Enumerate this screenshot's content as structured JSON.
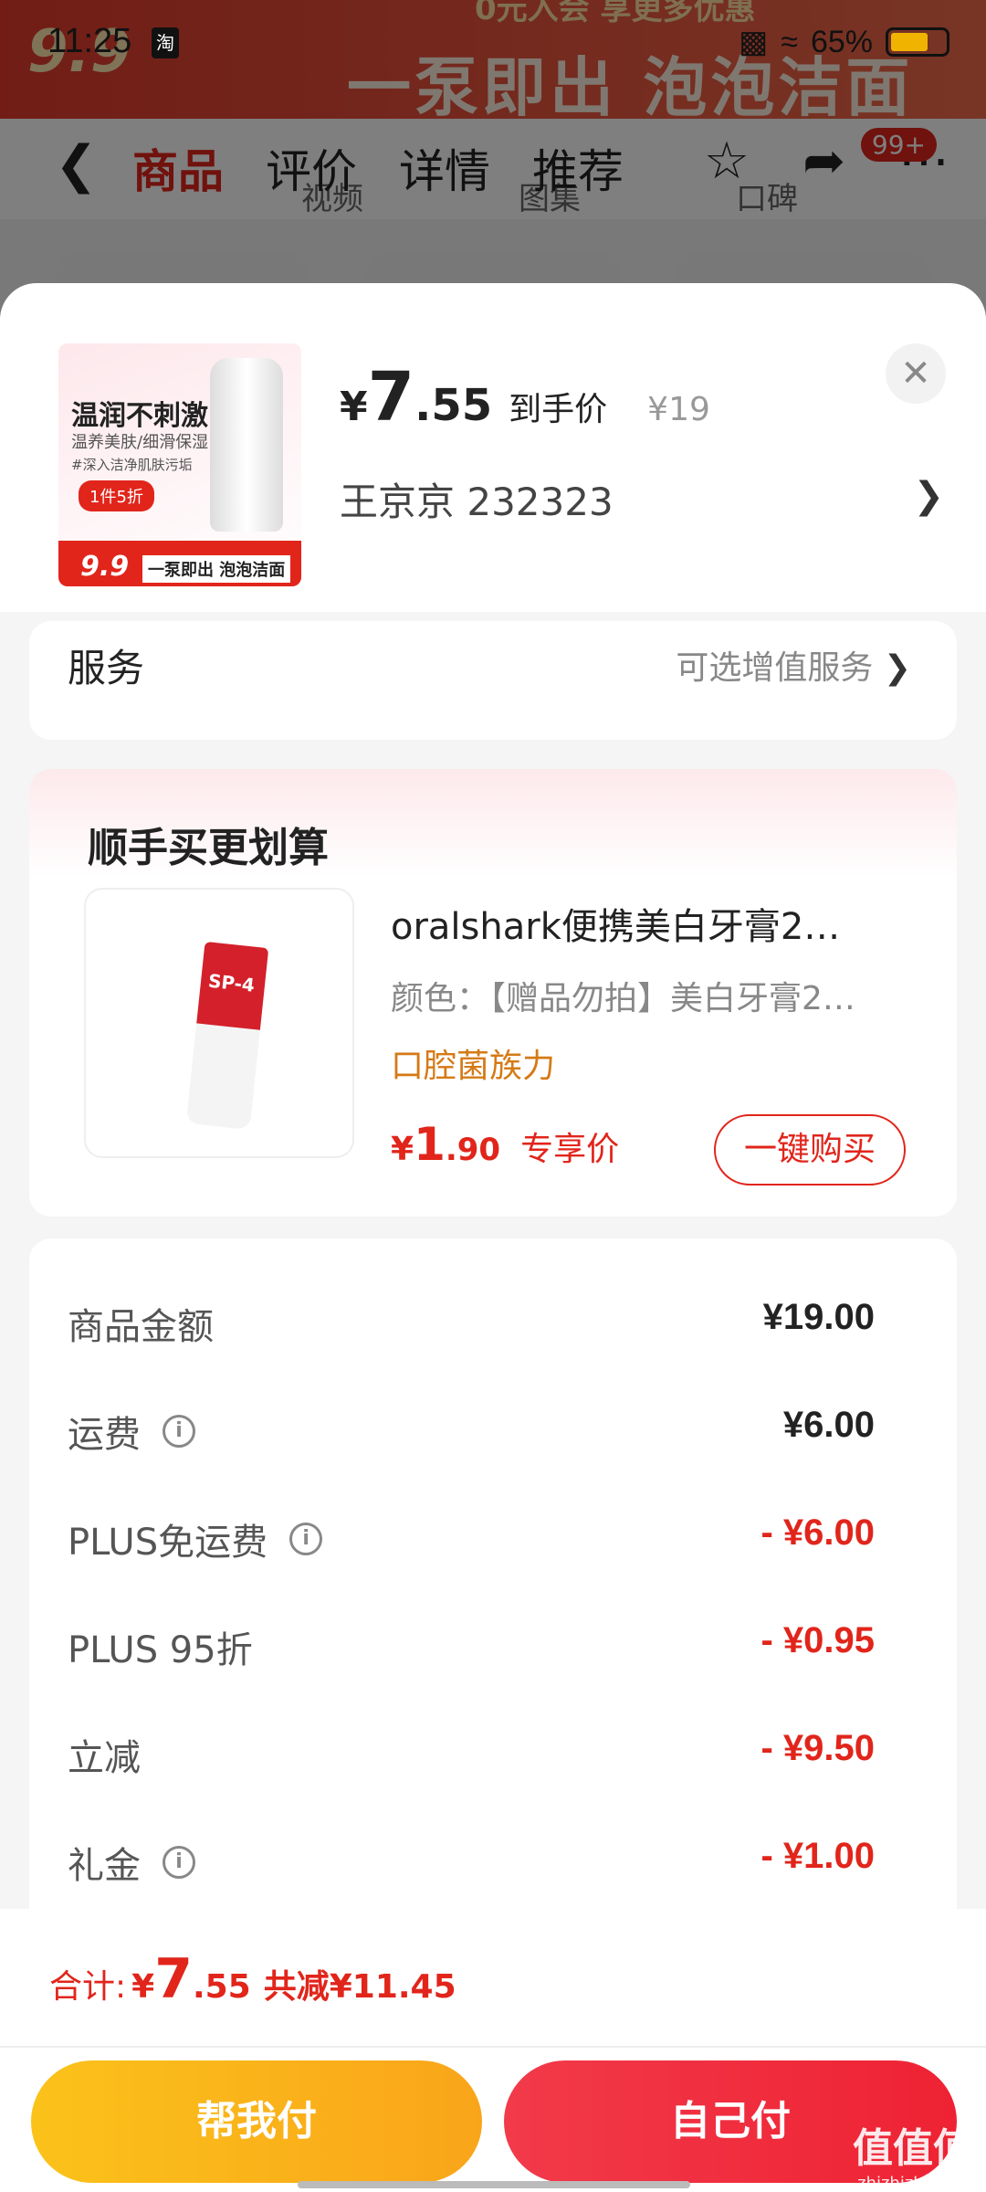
{
  "status_bar": {
    "time": "11:25",
    "app_badge": "淘",
    "battery_pct": "65%"
  },
  "background": {
    "banner_price": "9.9",
    "banner_slogan": "一泵即出 泡泡洁面",
    "banner_top": "0元入会 享更多优惠",
    "subtabs": [
      "视频",
      "图集",
      "口碑"
    ]
  },
  "nav": {
    "tabs": [
      "商品",
      "评价",
      "详情",
      "推荐"
    ],
    "badge": "99+",
    "icons": [
      "back-icon",
      "star-icon",
      "share-icon",
      "more-icon"
    ]
  },
  "product": {
    "thumb_title": "温润不刺激",
    "thumb_sub": "温养美肤/细滑保湿",
    "thumb_sub2": "#深入洁净肌肤污垢",
    "thumb_pill": "1件5折",
    "thumb_price": "9.9",
    "thumb_slogan": "一泵即出 泡泡洁面",
    "price_currency": "¥",
    "price_int": "7",
    "price_dec": ".55",
    "price_label": "到手价",
    "orig_price": "¥19",
    "spec": "王京京   232323"
  },
  "service": {
    "label": "服务",
    "value": "可选增值服务"
  },
  "bundle": {
    "title": "顺手买更划算",
    "image_label": "SP-4",
    "name": "oralshark便携美白牙膏2…",
    "color": "颜色：【赠品勿拍】美白牙膏2…",
    "tag": "口腔菌族力",
    "price_currency": "¥",
    "price_int": "1",
    "price_dec": ".90",
    "price_label": "专享价",
    "buy_label": "一键购买"
  },
  "summary": {
    "rows": [
      {
        "label": "商品金额",
        "value": "¥19.00",
        "info": false,
        "negative": false
      },
      {
        "label": "运费",
        "value": "¥6.00",
        "info": true,
        "negative": false
      },
      {
        "label": "PLUS免运费",
        "value": "- ¥6.00",
        "info": true,
        "negative": true
      },
      {
        "label": "PLUS 95折",
        "value": "- ¥0.95",
        "info": false,
        "negative": true
      },
      {
        "label": "立减",
        "value": "- ¥9.50",
        "info": false,
        "negative": true
      },
      {
        "label": "礼金",
        "value": "- ¥1.00",
        "info": true,
        "negative": true
      }
    ]
  },
  "footer": {
    "total_label": "合计:",
    "total_currency": "¥",
    "total_int": "7",
    "total_dec": ".55",
    "saved": "共减¥11.45",
    "help_pay": "帮我付",
    "self_pay": "自己付",
    "watermark": "值值值",
    "watermark_sub": "zhizhizhi.com"
  },
  "colors": {
    "accent": "#e1251b",
    "tag": "#d57a16",
    "help_btn": "#fbc21a",
    "self_btn": "#ee2233"
  }
}
